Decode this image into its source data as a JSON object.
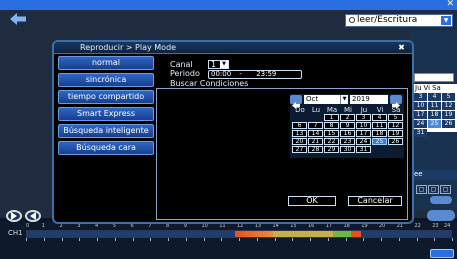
{
  "background": {
    "access_mode": "leer/Escritura",
    "right_calendar": {
      "days": [
        "Ju",
        "Vi",
        "Sa"
      ],
      "rows": [
        [
          "3",
          "4",
          "5"
        ],
        [
          "10",
          "11",
          "12"
        ],
        [
          "17",
          "18",
          "19"
        ],
        [
          "24",
          "25",
          "26"
        ],
        [
          "31",
          "",
          ""
        ]
      ],
      "selected": "25"
    },
    "right_label": "ee",
    "timeline": {
      "channel": "CH1",
      "hours": [
        "0",
        "1",
        "2",
        "3",
        "4",
        "5",
        "6",
        "7",
        "8",
        "9",
        "10",
        "11",
        "12",
        "13",
        "14",
        "15",
        "16",
        "17",
        "18",
        "19",
        "20",
        "21",
        "22",
        "23",
        "24"
      ]
    }
  },
  "dialog": {
    "title": "Reproducir > Play Mode",
    "modes": [
      "normal",
      "sincrónica",
      "tiempo compartido",
      "Smart Express",
      "Búsqueda inteligente",
      "Búsqueda cara"
    ],
    "canal_label": "Canal",
    "canal_value": "1",
    "periodo_label": "Periodo",
    "periodo_start": "00:00",
    "periodo_sep": "-",
    "periodo_end": "23:59",
    "search_label": "Buscar Condiciones",
    "calendar": {
      "month": "Oct",
      "year": "2019",
      "weekdays": [
        "Do",
        "Lu",
        "Ma",
        "Mi",
        "Ju",
        "Vi",
        "Sa"
      ],
      "today": "25",
      "weeks": [
        [
          "",
          "",
          "1",
          "2",
          "3",
          "4",
          "5"
        ],
        [
          "6",
          "7",
          "8",
          "9",
          "10",
          "11",
          "12"
        ],
        [
          "13",
          "14",
          "15",
          "16",
          "17",
          "18",
          "19"
        ],
        [
          "20",
          "21",
          "22",
          "23",
          "24",
          "25",
          "26"
        ],
        [
          "27",
          "28",
          "29",
          "30",
          "31",
          "",
          ""
        ]
      ]
    },
    "ok_label": "OK",
    "cancel_label": "Cancelar"
  },
  "colors": {
    "accent": "#2a6fe0",
    "dialog_border": "#3d6fa8",
    "mode_button": "#2f66c8",
    "highlight": "#3a7ad4"
  }
}
